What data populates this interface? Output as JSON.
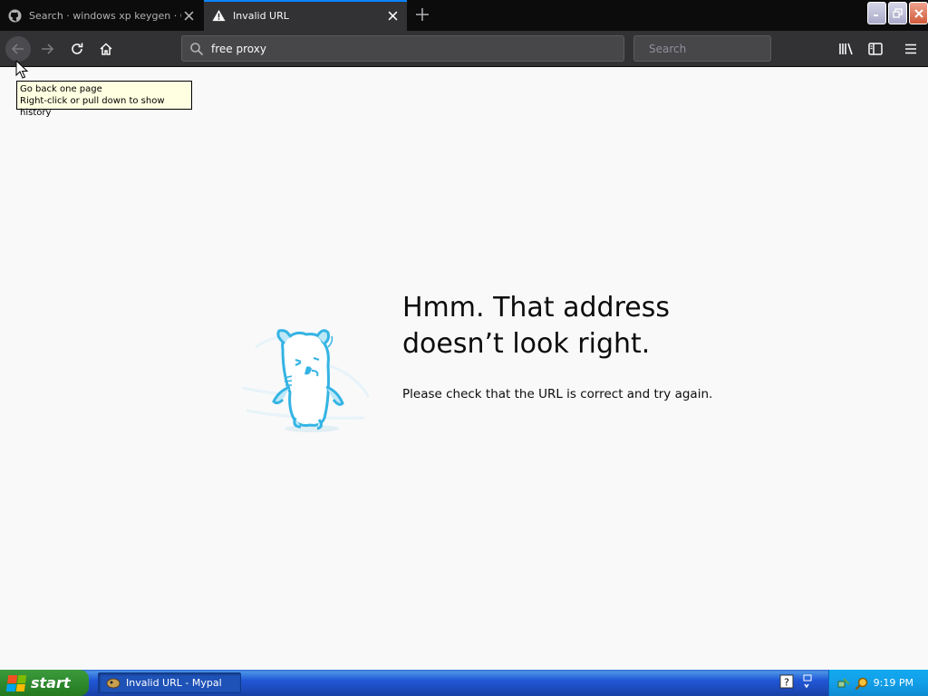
{
  "browser": {
    "tabs": [
      {
        "label": "Search · windows xp keygen · GitHub",
        "active": false,
        "icon": "github-icon"
      },
      {
        "label": "Invalid URL",
        "active": true,
        "icon": "warning-icon"
      }
    ],
    "url_value": "free proxy",
    "search_placeholder": "Search",
    "tooltip_line1": "Go back one page",
    "tooltip_line2": "Right-click or pull down to show history",
    "accent": "#0a84ff"
  },
  "error_page": {
    "title_line1": "Hmm. That address",
    "title_line2": "doesn’t look right.",
    "description": "Please check that the URL is correct and try again.",
    "illustration": "confused-pocket-creature-icon"
  },
  "taskbar": {
    "start_label": "start",
    "task_label": "Invalid URL - Mypal",
    "clock": "9:19 PM"
  }
}
